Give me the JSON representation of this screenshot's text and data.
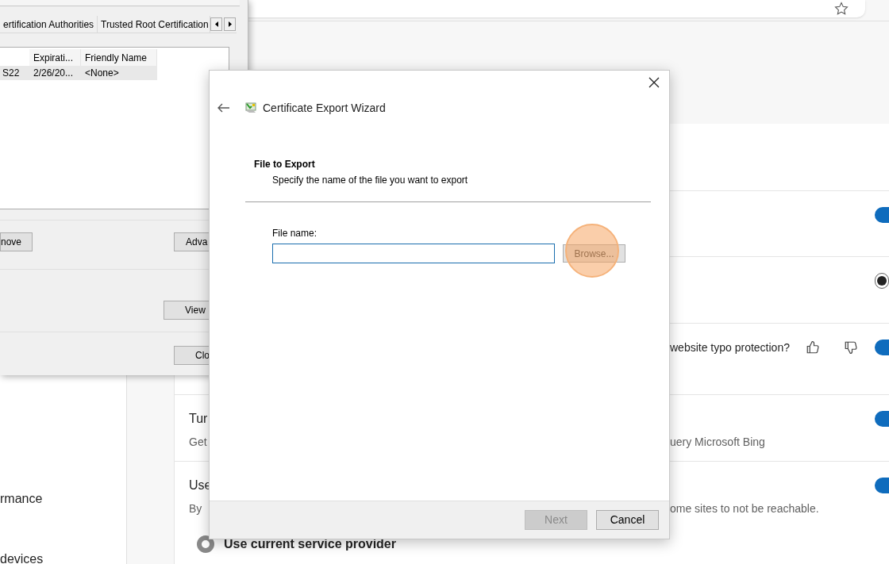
{
  "browser": {
    "sidebar_items": [
      "rmance",
      "devices"
    ],
    "settings_rows": [
      {
        "kind": "toggle",
        "on": true
      },
      {
        "kind": "radio",
        "selected": true
      },
      {
        "kind": "toggle",
        "on": true,
        "title_right": "website typo protection?",
        "feedback": true
      },
      {
        "kind": "toggle",
        "on": true,
        "title_left": "Tur",
        "desc_left": "Get",
        "desc_right": "uery Microsoft Bing"
      },
      {
        "kind": "toggle",
        "on": true,
        "title_left": "Use",
        "desc_left": "By",
        "desc_right": "ome sites to not be reachable.",
        "option": {
          "label": "Use current service provider",
          "selected": true
        }
      }
    ]
  },
  "certificates_dialog": {
    "tabs": [
      {
        "label": "ertification Authorities",
        "selected": false
      },
      {
        "label": "Trusted Root Certification",
        "selected": false
      }
    ],
    "columns": [
      "",
      "Expirati...",
      "Friendly Name"
    ],
    "rows": [
      {
        "cells": [
          "S22",
          "2/26/20...",
          "<None>"
        ],
        "selected": true
      }
    ],
    "buttons": [
      "nove",
      "Adva",
      "View",
      "Clo"
    ]
  },
  "wizard": {
    "title": "Certificate Export Wizard",
    "heading": "File to Export",
    "subheading": "Specify the name of the file you want to export",
    "field_label": "File name:",
    "browse": "Browse...",
    "next": {
      "label": "Next",
      "disabled": true
    },
    "cancel": "Cancel"
  }
}
